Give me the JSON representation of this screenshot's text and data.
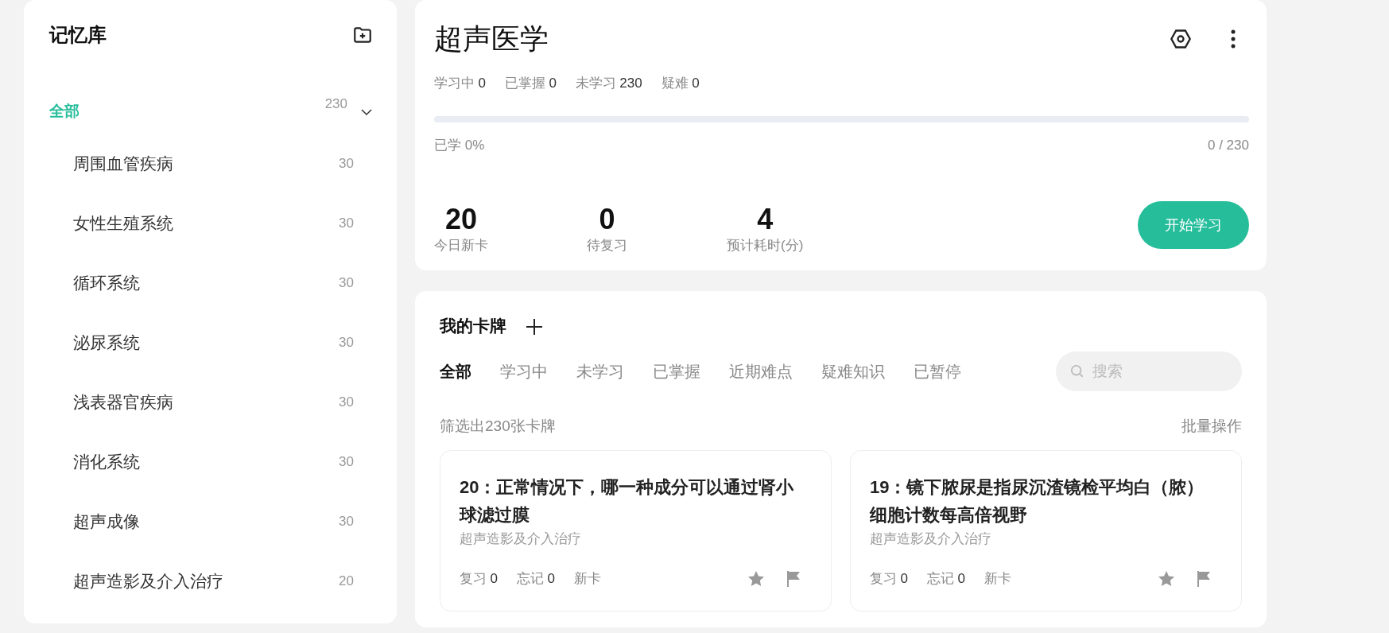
{
  "sidebar": {
    "title": "记忆库",
    "root": {
      "label": "全部",
      "count": "230",
      "selected": true,
      "expanded": true,
      "children": [
        {
          "label": "周围血管疾病",
          "count": "30",
          "selected": false
        },
        {
          "label": "女性生殖系统",
          "count": "30",
          "selected": false
        },
        {
          "label": "循环系统",
          "count": "30",
          "selected": false
        },
        {
          "label": "泌尿系统",
          "count": "30",
          "selected": false
        },
        {
          "label": "浅表器官疾病",
          "count": "30",
          "selected": false
        },
        {
          "label": "消化系统",
          "count": "30",
          "selected": false
        },
        {
          "label": "超声成像",
          "count": "30",
          "selected": false
        },
        {
          "label": "超声造影及介入治疗",
          "count": "20",
          "selected": false
        }
      ]
    }
  },
  "deck": {
    "title": "超声医学",
    "stats": [
      {
        "label": "学习中",
        "value": "0"
      },
      {
        "label": "已掌握",
        "value": "0"
      },
      {
        "label": "未学习",
        "value": "230"
      },
      {
        "label": "疑难",
        "value": "0"
      }
    ],
    "progress": {
      "label": "已学 0%",
      "reading": "0 / 230"
    },
    "summary": [
      {
        "value": "20",
        "label": "今日新卡"
      },
      {
        "value": "0",
        "label": "待复习"
      },
      {
        "value": "4",
        "label": "预计耗时(分)"
      }
    ],
    "start_button": "开始学习"
  },
  "cards_panel": {
    "title": "我的卡牌",
    "tabs": [
      {
        "label": "全部",
        "selected": true
      },
      {
        "label": "学习中",
        "selected": false
      },
      {
        "label": "未学习",
        "selected": false
      },
      {
        "label": "已掌握",
        "selected": false
      },
      {
        "label": "近期难点",
        "selected": false
      },
      {
        "label": "疑难知识",
        "selected": false
      },
      {
        "label": "已暂停",
        "selected": false
      }
    ],
    "search": {
      "placeholder": "搜索"
    },
    "filter_text": "筛选出230张卡牌",
    "batch_action": "批量操作",
    "cards": [
      {
        "title": "20：正常情况下，哪一种成分可以通过肾小球滤过膜",
        "category": "超声造影及介入治疗",
        "stats": [
          {
            "label": "复习",
            "value": "0"
          },
          {
            "label": "忘记",
            "value": "0"
          },
          {
            "label": "新卡"
          }
        ]
      },
      {
        "title": "19：镜下脓尿是指尿沉渣镜检平均白（脓）细胞计数每高倍视野",
        "category": "超声造影及介入治疗",
        "stats": [
          {
            "label": "复习",
            "value": "0"
          },
          {
            "label": "忘记",
            "value": "0"
          },
          {
            "label": "新卡"
          }
        ]
      }
    ]
  }
}
